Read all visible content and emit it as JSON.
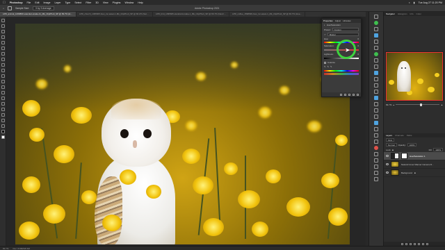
{
  "menubar": {
    "app": "Photoshop",
    "items": [
      "File",
      "Edit",
      "Image",
      "Layer",
      "Type",
      "Select",
      "Filter",
      "3D",
      "View",
      "Plugins",
      "Window",
      "Help"
    ],
    "clock": "Tue Aug 27  11:20 PM"
  },
  "options": {
    "tool_preset": "Sample Size:",
    "sample_size": "3 by 3 Average",
    "window_title": "Adobe Photoshop 2021"
  },
  "tabs": [
    {
      "label": "LPR_animal_1469860-vascular-snake-11_Mk_ClipPhotI_SP @ 83.7% (Hue/Saturation 1, Layer Mask/16) *",
      "active": true
    },
    {
      "label": "LPR_church_1395605-how_inc-asset-1-Mk_ClipPhotI_SP @ 66.2% (Saturation...",
      "active": false
    },
    {
      "label": "LPR_bird_1395605-standard-snake-1_Mk_ClipPhotI_SP @ 66.7% (Neutral...",
      "active": false
    },
    {
      "label": "LPR_coffee_1598636-how_inc-asset-1_Mk_ClipPhotI_SP @ 66.7% (Hue...",
      "active": false
    }
  ],
  "properties": {
    "tabs": [
      "Properties",
      "Adjust",
      "Libraries"
    ],
    "title": "Hue/Saturation",
    "preset_label": "Preset:",
    "preset_value": "Custom",
    "channel_value": "Master",
    "hue_label": "Hue:",
    "hue_value": "0",
    "saturation_label": "Saturation:",
    "saturation_value": "0",
    "lightness_label": "Lightness:",
    "lightness_value": "0",
    "colorize_label": "Colorize"
  },
  "navigator": {
    "tabs": [
      "Navigator",
      "Histogram",
      "Info",
      "Color"
    ],
    "zoom": "83.7%"
  },
  "layers": {
    "tabs": [
      "Layers",
      "Channels",
      "Paths"
    ],
    "kind_label": "Kind",
    "blend_mode": "Normal",
    "opacity_label": "Opacity:",
    "opacity_value": "100%",
    "lock_label": "Lock:",
    "fill_label": "Fill:",
    "fill_value": "100%",
    "items": [
      {
        "name": "Hue/Saturation 1",
        "selected": true,
        "kind": "adj"
      },
      {
        "name": "Natural Cover Manner Camera Raw Saturation Shift",
        "selected": false,
        "kind": "img1"
      },
      {
        "name": "Background",
        "selected": false,
        "kind": "img2"
      }
    ]
  },
  "status": {
    "zoom": "83.7%",
    "doc": "Doc: 8.89M/26.6M"
  },
  "colors": {
    "accent": "#3ed33e",
    "selection": "#4fa3e0"
  }
}
